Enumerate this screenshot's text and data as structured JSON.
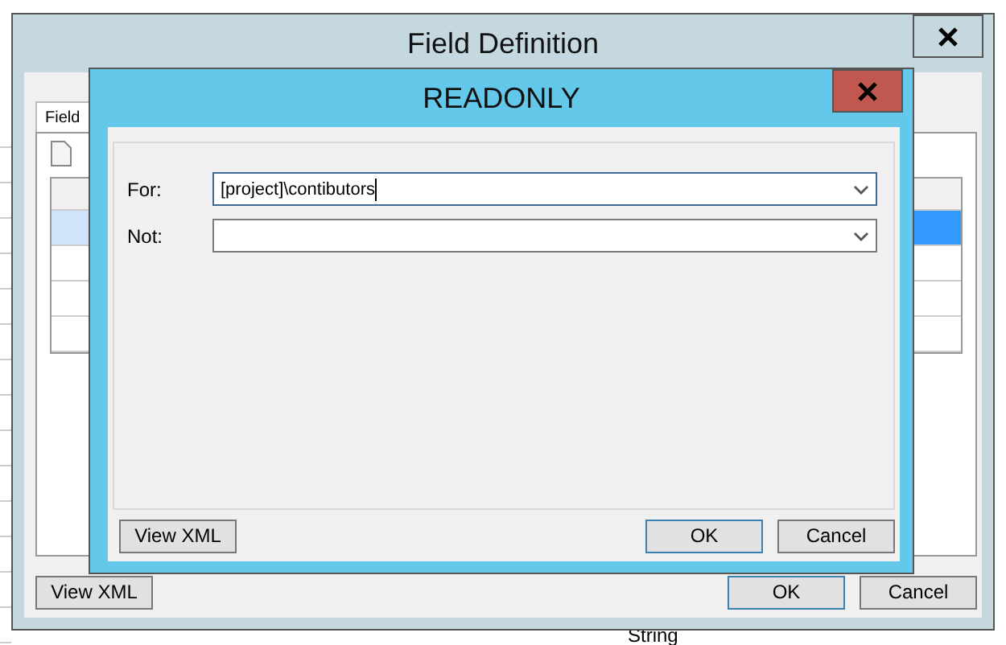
{
  "background": {
    "bottom_text": "String"
  },
  "field_definition": {
    "title": "Field Definition",
    "tabs": [
      {
        "label": "Field",
        "selected": true
      }
    ],
    "grid_rows": [
      {
        "selected": true
      },
      {
        "selected": false
      },
      {
        "selected": false
      },
      {
        "selected": false
      }
    ],
    "buttons": [
      {
        "label": "View XML",
        "default": false
      },
      {
        "label": "OK",
        "default": true
      },
      {
        "label": "Cancel",
        "default": false
      }
    ]
  },
  "readonly_dialog": {
    "title": "READONLY",
    "fields": [
      {
        "label": "For:",
        "value": "[project]\\contibutors",
        "focused": true
      },
      {
        "label": "Not:",
        "focused": false
      }
    ],
    "buttons": [
      {
        "label": "View XML",
        "default": false
      },
      {
        "label": "OK",
        "default": true
      },
      {
        "label": "Cancel",
        "default": false
      }
    ]
  }
}
